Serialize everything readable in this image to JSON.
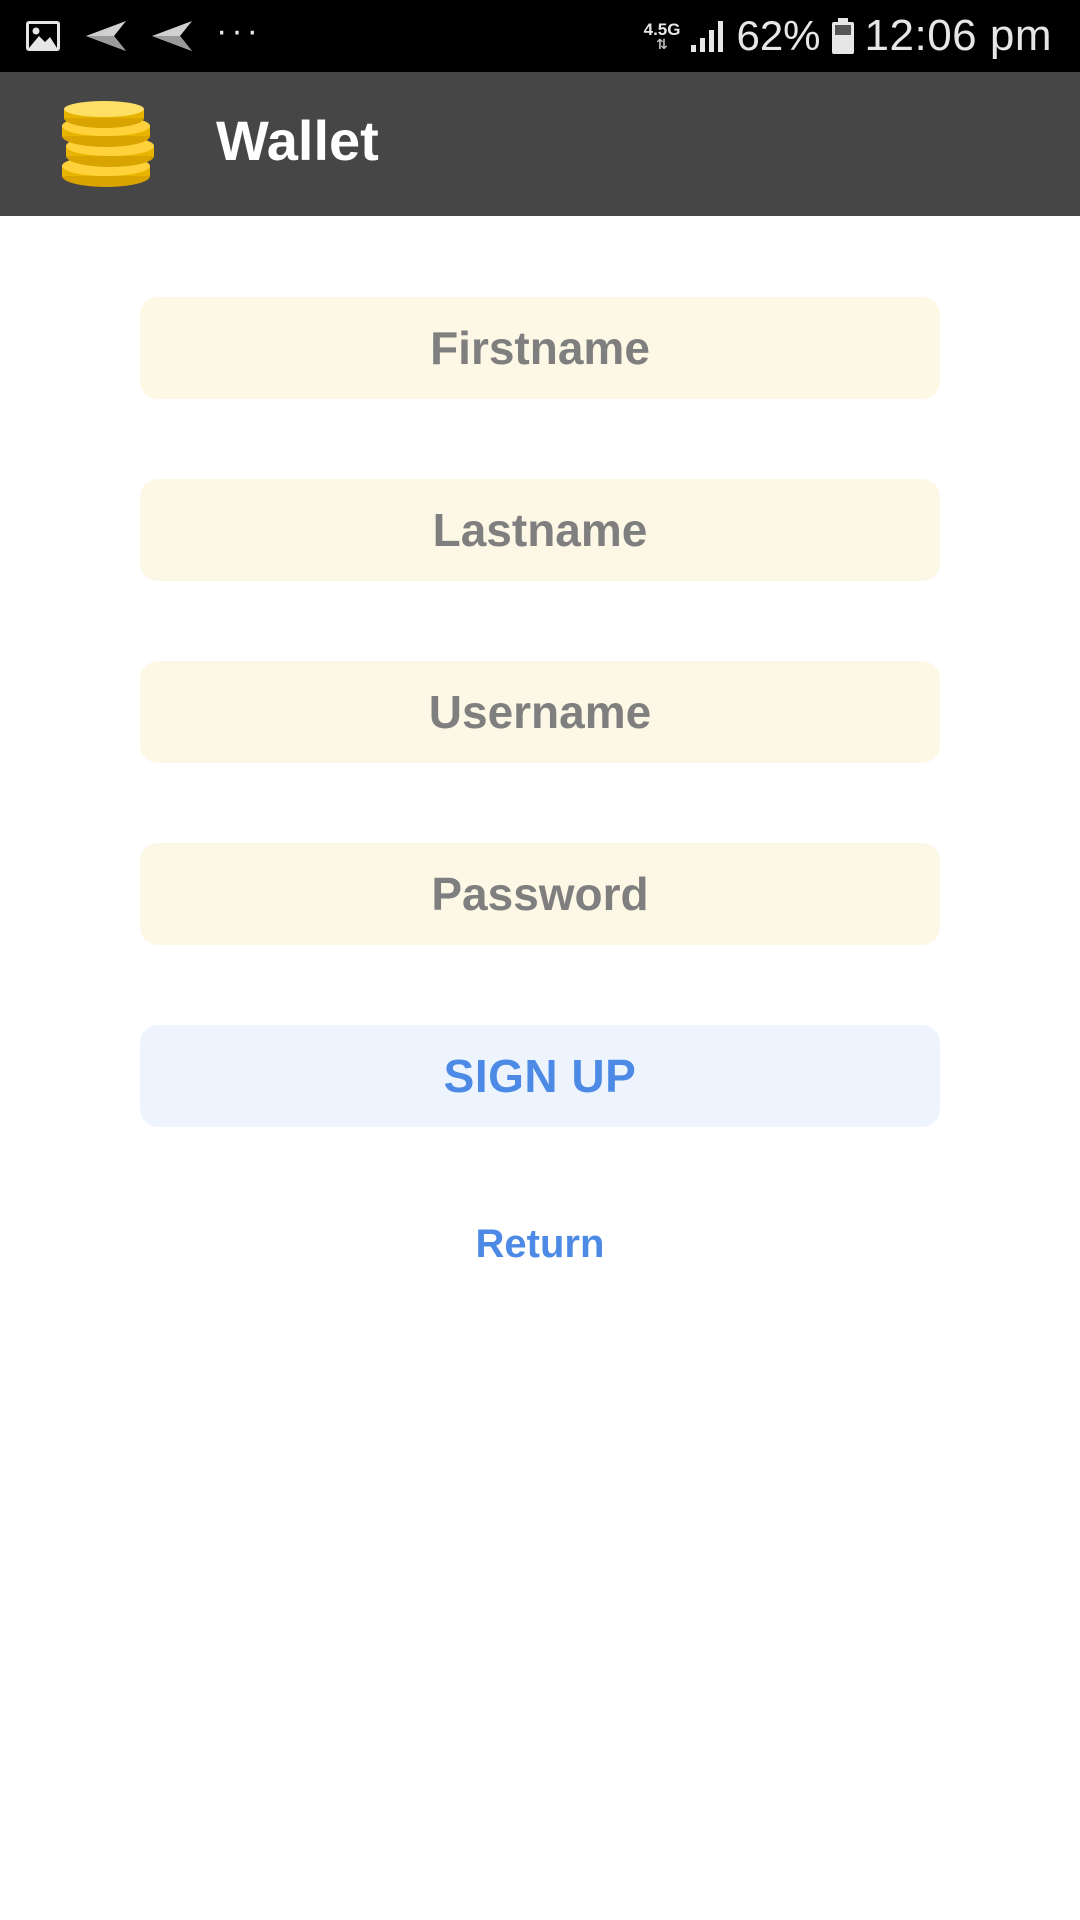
{
  "status_bar": {
    "network": "4.5G",
    "battery": "62%",
    "time": "12:06 pm",
    "overflow": "···",
    "icons": [
      "gallery-icon",
      "send-icon",
      "send-icon",
      "more-dots-icon",
      "signal-icon",
      "battery-icon"
    ]
  },
  "app_bar": {
    "title": "Wallet",
    "logo_icon": "coins-icon"
  },
  "form": {
    "firstname_placeholder": "Firstname",
    "lastname_placeholder": "Lastname",
    "username_placeholder": "Username",
    "password_placeholder": "Password",
    "signup_label": "SIGN UP",
    "return_label": "Return"
  },
  "colors": {
    "status_bar": "#000000",
    "app_bar": "#464646",
    "field_bg": "#fdf8e6",
    "button_bg": "#eef4fd",
    "accent": "#4d8ae6",
    "placeholder": "#7f7f7f"
  }
}
